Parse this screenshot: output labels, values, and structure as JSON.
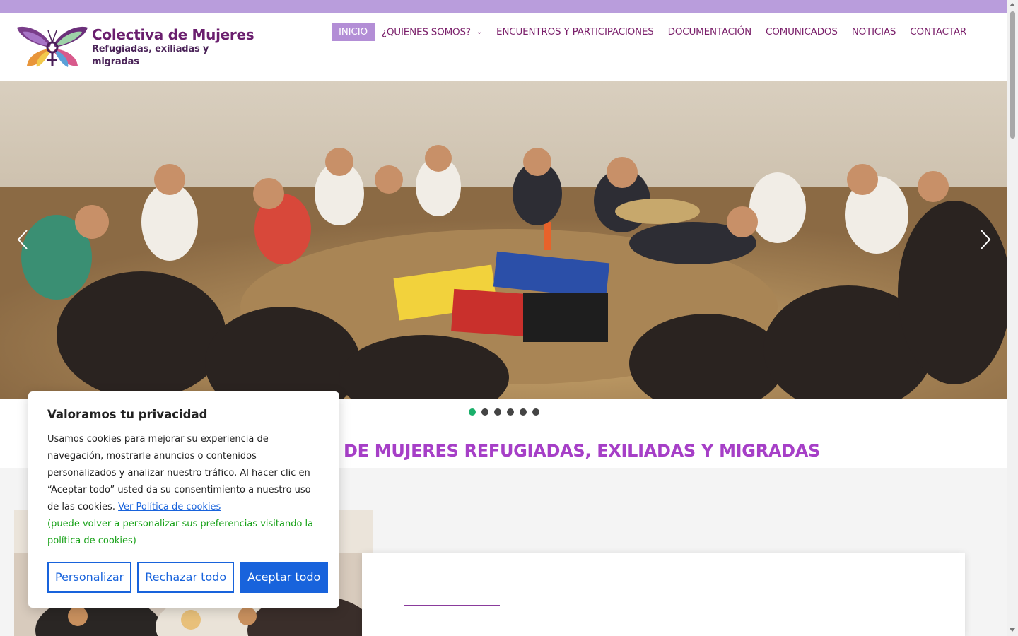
{
  "colors": {
    "topbar": "#b99ddc",
    "nav_text": "#7a1f6a",
    "nav_active_bg": "#b38ed6",
    "heading": "#a63fc7",
    "cookie_accent": "#1863dc",
    "cookie_note": "#15a015",
    "dot_active": "#1aaf6a"
  },
  "logo": {
    "title": "Colectiva de Mujeres",
    "subtitle": "Refugiadas, exiliadas y migradas",
    "icon": "butterfly-venus-icon"
  },
  "nav": {
    "items": [
      {
        "label": "INICIO",
        "active": true
      },
      {
        "label": "¿QUIENES SOMOS?",
        "has_dropdown": true
      },
      {
        "label": "ENCUENTROS Y PARTICIPACIONES"
      },
      {
        "label": "DOCUMENTACIÓN"
      },
      {
        "label": "COMUNICADOS"
      },
      {
        "label": "NOTICIAS"
      },
      {
        "label": "CONTACTAR"
      }
    ]
  },
  "slider": {
    "prev_icon": "chevron-left-icon",
    "next_icon": "chevron-right-icon",
    "slide_count": 6,
    "active_index": 0
  },
  "main": {
    "heading": "DE MUJERES REFUGIADAS, EXILIADAS Y MIGRADAS"
  },
  "cookie": {
    "title": "Valoramos tu privacidad",
    "body": "Usamos cookies para mejorar su experiencia de navegación, mostrarle anuncios o contenidos personalizados y analizar nuestro tráfico. Al hacer clic en “Aceptar todo” usted da su consentimiento a nuestro uso de las cookies.",
    "link": "Ver Política de cookies",
    "note": "(puede volver a personalizar sus preferencias visitando la política de cookies)",
    "buttons": {
      "customize": "Personalizar",
      "reject": "Rechazar todo",
      "accept": "Aceptar todo"
    }
  }
}
